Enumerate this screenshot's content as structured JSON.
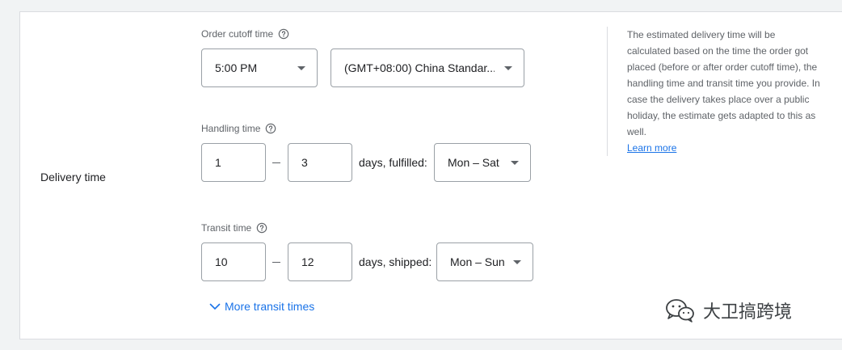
{
  "section": {
    "label": "Delivery time"
  },
  "order_cutoff": {
    "label": "Order cutoff time",
    "time_value": "5:00 PM",
    "timezone_value": "(GMT+08:00) China Standar..."
  },
  "handling": {
    "label": "Handling time",
    "min": "1",
    "max": "3",
    "unit_text": "days, fulfilled:",
    "days_value": "Mon – Sat"
  },
  "transit": {
    "label": "Transit time",
    "min": "10",
    "max": "12",
    "unit_text": "days, shipped:",
    "days_value": "Mon – Sun"
  },
  "more_transit": {
    "label": "More transit times"
  },
  "help": {
    "text": "The estimated delivery time will be calculated based on the time the order got placed (before or after order cutoff time), the handling time and transit time you provide. In case the delivery takes place over a public holiday, the estimate gets adapted to this as well.",
    "link": "Learn more"
  },
  "watermark": {
    "text": "大卫搞跨境"
  },
  "colors": {
    "link": "#1a73e8",
    "border": "#9aa0a6",
    "muted": "#5f6368"
  },
  "icons": [
    "help-circle-icon",
    "chevron-down-icon",
    "wechat-icon"
  ]
}
